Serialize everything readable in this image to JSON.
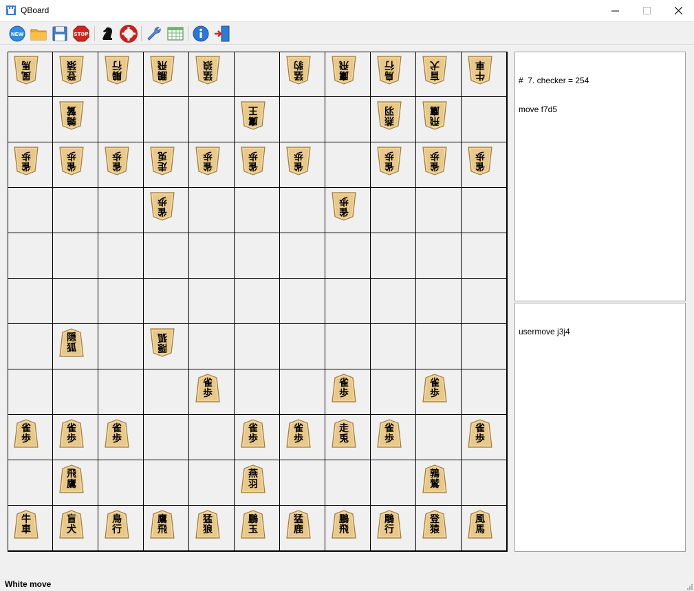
{
  "window": {
    "title": "QBoard"
  },
  "toolbar": {
    "buttons": [
      {
        "name": "new-game-button",
        "icon": "new-icon",
        "label": "NEW"
      },
      {
        "name": "open-button",
        "icon": "folder-icon"
      },
      {
        "name": "save-button",
        "icon": "floppy-disk-icon"
      },
      {
        "name": "stop-button",
        "icon": "stop-sign-icon",
        "label": "STOP"
      },
      {
        "name": "engine-button",
        "icon": "chess-knight-icon"
      },
      {
        "name": "help-ring-button",
        "icon": "lifebuoy-icon"
      },
      {
        "name": "settings-button",
        "icon": "wrench-icon"
      },
      {
        "name": "table-button",
        "icon": "grid-table-icon"
      },
      {
        "name": "about-button",
        "icon": "info-icon"
      },
      {
        "name": "exit-button",
        "icon": "exit-door-icon"
      }
    ]
  },
  "colors": {
    "piece_fill": "#e8c98a",
    "piece_edge": "#a07a3a",
    "cell_bg": "#f0f0f0",
    "grid_line": "#000000"
  },
  "board": {
    "files": 11,
    "ranks": 11,
    "pieces": [
      {
        "r": 0,
        "c": 0,
        "t": "風馬",
        "side": "gote"
      },
      {
        "r": 0,
        "c": 1,
        "t": "登猿",
        "side": "gote"
      },
      {
        "r": 0,
        "c": 2,
        "t": "鵰行",
        "side": "gote"
      },
      {
        "r": 0,
        "c": 3,
        "t": "鵬飛",
        "side": "gote"
      },
      {
        "r": 0,
        "c": 4,
        "t": "猛狼",
        "side": "gote"
      },
      {
        "r": 0,
        "c": 6,
        "t": "猛豹",
        "side": "gote"
      },
      {
        "r": 0,
        "c": 7,
        "t": "鷹飛",
        "side": "gote"
      },
      {
        "r": 0,
        "c": 8,
        "t": "鳥行",
        "side": "gote"
      },
      {
        "r": 0,
        "c": 9,
        "t": "盲犬",
        "side": "gote"
      },
      {
        "r": 0,
        "c": 10,
        "t": "牛車",
        "side": "gote"
      },
      {
        "r": 1,
        "c": 1,
        "t": "鶉鷲",
        "side": "gote"
      },
      {
        "r": 1,
        "c": 5,
        "t": "鷹王",
        "side": "gote"
      },
      {
        "r": 1,
        "c": 8,
        "t": "燕羽",
        "side": "gote"
      },
      {
        "r": 1,
        "c": 9,
        "t": "飛鷹",
        "side": "gote"
      },
      {
        "r": 2,
        "c": 0,
        "t": "雀歩",
        "side": "gote"
      },
      {
        "r": 2,
        "c": 1,
        "t": "雀歩",
        "side": "gote"
      },
      {
        "r": 2,
        "c": 2,
        "t": "雀歩",
        "side": "gote"
      },
      {
        "r": 2,
        "c": 3,
        "t": "走兎",
        "side": "gote"
      },
      {
        "r": 2,
        "c": 4,
        "t": "雀歩",
        "side": "gote"
      },
      {
        "r": 2,
        "c": 5,
        "t": "雀歩",
        "side": "gote"
      },
      {
        "r": 2,
        "c": 6,
        "t": "雀歩",
        "side": "gote"
      },
      {
        "r": 2,
        "c": 8,
        "t": "雀歩",
        "side": "gote"
      },
      {
        "r": 2,
        "c": 9,
        "t": "雀歩",
        "side": "gote"
      },
      {
        "r": 2,
        "c": 10,
        "t": "雀歩",
        "side": "gote"
      },
      {
        "r": 3,
        "c": 3,
        "t": "雀歩",
        "side": "gote"
      },
      {
        "r": 3,
        "c": 7,
        "t": "雀歩",
        "side": "gote"
      },
      {
        "r": 6,
        "c": 1,
        "t": "隠狐",
        "side": "sente"
      },
      {
        "r": 6,
        "c": 3,
        "t": "隠狐",
        "side": "gote"
      },
      {
        "r": 7,
        "c": 4,
        "t": "雀歩",
        "side": "sente"
      },
      {
        "r": 7,
        "c": 7,
        "t": "雀歩",
        "side": "sente"
      },
      {
        "r": 7,
        "c": 9,
        "t": "雀歩",
        "side": "sente"
      },
      {
        "r": 8,
        "c": 0,
        "t": "雀歩",
        "side": "sente"
      },
      {
        "r": 8,
        "c": 1,
        "t": "雀歩",
        "side": "sente"
      },
      {
        "r": 8,
        "c": 2,
        "t": "雀歩",
        "side": "sente"
      },
      {
        "r": 8,
        "c": 5,
        "t": "雀歩",
        "side": "sente"
      },
      {
        "r": 8,
        "c": 6,
        "t": "雀歩",
        "side": "sente"
      },
      {
        "r": 8,
        "c": 7,
        "t": "走兎",
        "side": "sente"
      },
      {
        "r": 8,
        "c": 8,
        "t": "雀歩",
        "side": "sente"
      },
      {
        "r": 8,
        "c": 10,
        "t": "雀歩",
        "side": "sente"
      },
      {
        "r": 9,
        "c": 1,
        "t": "飛鷹",
        "side": "sente"
      },
      {
        "r": 9,
        "c": 5,
        "t": "燕羽",
        "side": "sente"
      },
      {
        "r": 9,
        "c": 9,
        "t": "鶉鷲",
        "side": "sente"
      },
      {
        "r": 10,
        "c": 0,
        "t": "牛車",
        "side": "sente"
      },
      {
        "r": 10,
        "c": 1,
        "t": "盲犬",
        "side": "sente"
      },
      {
        "r": 10,
        "c": 2,
        "t": "鳥行",
        "side": "sente"
      },
      {
        "r": 10,
        "c": 3,
        "t": "鷹飛",
        "side": "sente"
      },
      {
        "r": 10,
        "c": 4,
        "t": "猛狼",
        "side": "sente"
      },
      {
        "r": 10,
        "c": 5,
        "t": "鵬玉",
        "side": "sente"
      },
      {
        "r": 10,
        "c": 6,
        "t": "猛鹿",
        "side": "sente"
      },
      {
        "r": 10,
        "c": 7,
        "t": "鵬飛",
        "side": "sente"
      },
      {
        "r": 10,
        "c": 8,
        "t": "鵰行",
        "side": "sente"
      },
      {
        "r": 10,
        "c": 9,
        "t": "登猿",
        "side": "sente"
      },
      {
        "r": 10,
        "c": 10,
        "t": "風馬",
        "side": "sente"
      }
    ]
  },
  "engine_output": {
    "lines": [
      "#  7. checker = 254",
      "move f7d5"
    ]
  },
  "user_input": {
    "lines": [
      "usermove j3j4"
    ]
  },
  "status": {
    "text": "White move"
  }
}
